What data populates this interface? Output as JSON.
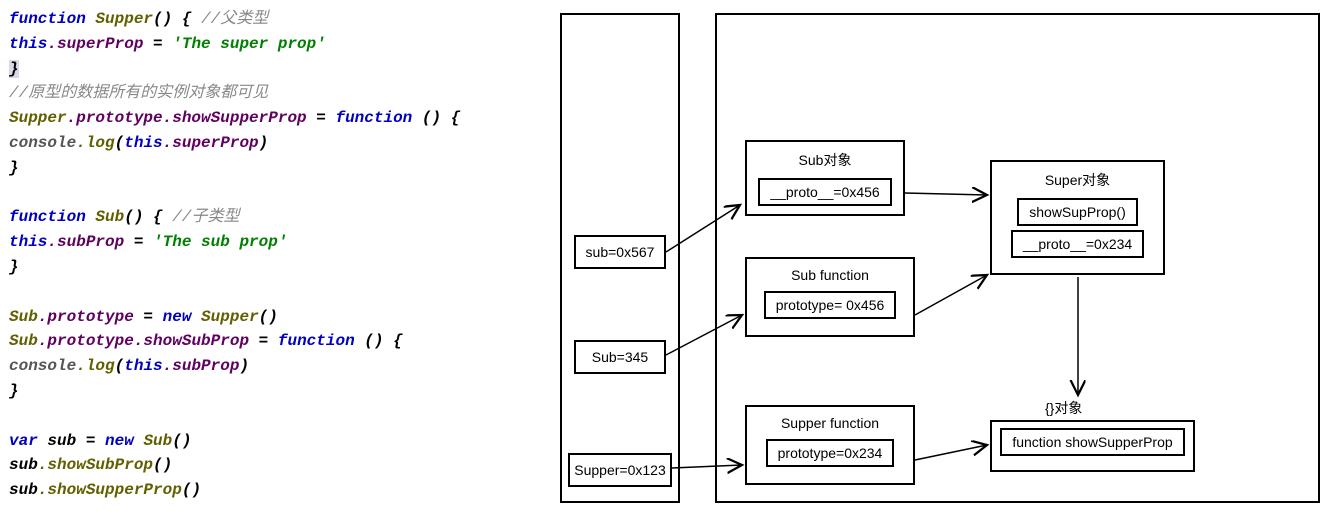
{
  "code": {
    "l1a": "function",
    "l1b": "Supper",
    "l1c": "() {",
    "l1d": "//父类型",
    "l2a": "  this",
    "l2b": ".superProp",
    "l2c": " = ",
    "l2d": "'The super prop'",
    "l3": "}",
    "l4": "//原型的数据所有的实例对象都可见",
    "l5a": "Supper",
    "l5b": ".prototype",
    "l5c": ".showSupperProp",
    "l5d": " = ",
    "l5e": "function",
    "l5f": " () {",
    "l6a": "    console",
    "l6b": ".log",
    "l6c": "(",
    "l6d": "this",
    "l6e": ".superProp",
    "l6f": ")",
    "l7": "}",
    "l8": "",
    "l9a": "function",
    "l9b": "Sub",
    "l9c": "() {",
    "l9d": "//子类型",
    "l10a": "  this",
    "l10b": ".subProp",
    "l10c": " = ",
    "l10d": "'The sub prop'",
    "l11": "}",
    "l12": "",
    "l13a": "Sub",
    "l13b": ".prototype",
    "l13c": " = ",
    "l13d": "new",
    "l13e": " Supper",
    "l13f": "()",
    "l14a": "Sub",
    "l14b": ".prototype",
    "l14c": ".showSubProp",
    "l14d": " = ",
    "l14e": "function",
    "l14f": " () {",
    "l15a": "    console",
    "l15b": ".log",
    "l15c": "(",
    "l15d": "this",
    "l15e": ".subProp",
    "l15f": ")",
    "l16": "}",
    "l17": "",
    "l18a": "var",
    "l18b": " sub",
    "l18c": " = ",
    "l18d": "new",
    "l18e": " Sub",
    "l18f": "()",
    "l19a": "sub",
    "l19b": ".showSubProp",
    "l19c": "()",
    "l20a": "sub",
    "l20b": ".showSupperProp",
    "l20c": "()"
  },
  "diagram": {
    "stack": {
      "sub": "sub=0x567",
      "Sub": "Sub=345",
      "Supper": "Supper=0x123"
    },
    "subObj": {
      "title": "Sub对象",
      "proto": "__proto__=0x456"
    },
    "subFn": {
      "title": "Sub function",
      "proto": "prototype= 0x456"
    },
    "supperFn": {
      "title": "Supper function",
      "proto": "prototype=0x234"
    },
    "superObj": {
      "title": "Super对象",
      "show": "showSupProp()",
      "proto": "__proto__=0x234"
    },
    "emptyObj": {
      "title": "{}对象",
      "fn": "function showSupperProp"
    }
  }
}
